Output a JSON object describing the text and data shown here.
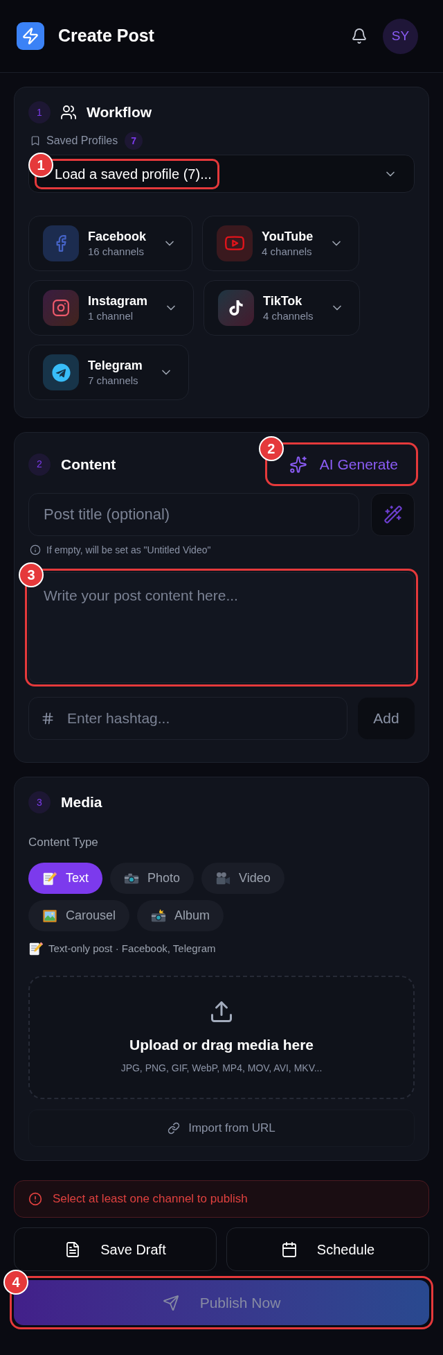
{
  "header": {
    "title": "Create Post",
    "avatar": "SY"
  },
  "workflow": {
    "step": "1",
    "title": "Workflow",
    "saved_profiles": {
      "label": "Saved Profiles",
      "count": "7"
    },
    "profile_select": {
      "value": "Load a saved profile (7)...",
      "callout": "1"
    },
    "platforms": [
      {
        "kind": "facebook",
        "name": "Facebook",
        "channels": "16 channels"
      },
      {
        "kind": "youtube",
        "name": "YouTube",
        "channels": "4 channels"
      },
      {
        "kind": "instagram",
        "name": "Instagram",
        "channels": "1 channel"
      },
      {
        "kind": "tiktok",
        "name": "TikTok",
        "channels": "4 channels"
      },
      {
        "kind": "telegram",
        "name": "Telegram",
        "channels": "7 channels"
      }
    ]
  },
  "content": {
    "step": "2",
    "title": "Content",
    "ai_button": {
      "label": "AI Generate",
      "callout": "2"
    },
    "title_field": {
      "placeholder": "Post title (optional)"
    },
    "hint": "If empty, will be set as \"Untitled Video\"",
    "body_field": {
      "placeholder": "Write your post content here...",
      "callout": "3"
    },
    "hashtag_field": {
      "placeholder": "Enter hashtag..."
    },
    "add_button": {
      "label": "Add"
    }
  },
  "media": {
    "step": "3",
    "title": "Media",
    "content_type_label": "Content Type",
    "content_types": [
      {
        "kind": "text",
        "label": "Text",
        "selected": true
      },
      {
        "kind": "photo",
        "label": "Photo",
        "selected": false
      },
      {
        "kind": "video",
        "label": "Video",
        "selected": false
      },
      {
        "kind": "carousel",
        "label": "Carousel",
        "selected": false
      },
      {
        "kind": "album",
        "label": "Album",
        "selected": false
      }
    ],
    "summary": "Text-only post · Facebook, Telegram",
    "dropzone": {
      "title": "Upload or drag media here",
      "formats": "JPG, PNG, GIF, WebP, MP4, MOV, AVI, MKV..."
    },
    "import_button": {
      "label": "Import from URL"
    }
  },
  "alert": {
    "message": "Select at least one channel to publish"
  },
  "actions": [
    {
      "kind": "draft",
      "label": "Save Draft"
    },
    {
      "kind": "schedule",
      "label": "Schedule"
    }
  ],
  "publish_button": {
    "label": "Publish Now",
    "disabled": true,
    "callout": "4"
  }
}
